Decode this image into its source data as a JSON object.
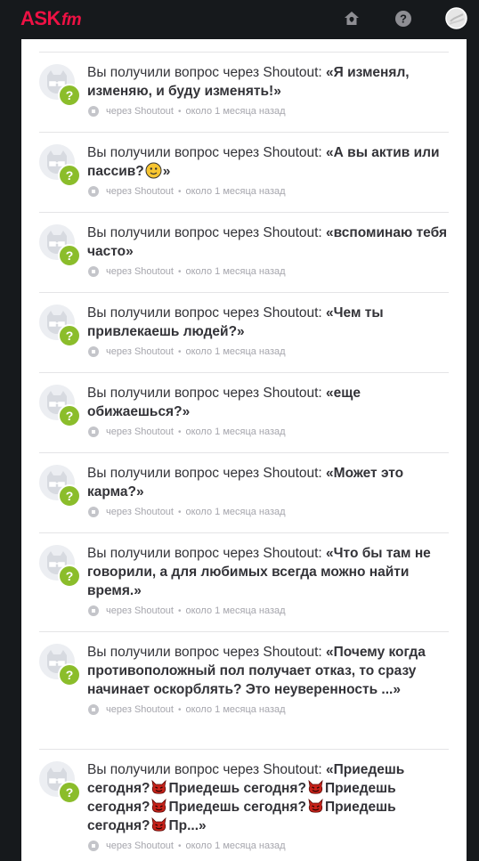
{
  "header": {
    "logo_main": "ASK",
    "logo_suffix": "fm",
    "icons": [
      "home-icon",
      "help-icon",
      "avatar-icon"
    ],
    "help_glyph": "?"
  },
  "colors": {
    "brand": "#ee1144",
    "question_badge": "#8bbd2b",
    "text": "#333338",
    "meta": "#a6a6ad",
    "background": "#16191c"
  },
  "feed": {
    "prefix": "Вы получили вопрос через Shoutout: ",
    "source": "через Shoutout",
    "separator": "•",
    "time": "около 1 месяца назад",
    "items": [
      {
        "question": "«Я изменял, изменяю, и буду изменять!»",
        "parts": [
          {
            "t": "«Я изменял, изменяю, и буду изменять!»"
          }
        ]
      },
      {
        "question": "«А вы актив или пассив?🙂»",
        "parts": [
          {
            "t": "«А вы актив или пассив?"
          },
          {
            "e": "smile"
          },
          {
            "t": "»"
          }
        ]
      },
      {
        "question": "«вспоминаю тебя часто»",
        "parts": [
          {
            "t": "«вспоминаю тебя часто»"
          }
        ]
      },
      {
        "question": "«Чем ты привлекаешь людей?»",
        "parts": [
          {
            "t": "«Чем ты привлекаешь людей?»"
          }
        ]
      },
      {
        "question": "«еще обижаешься?»",
        "parts": [
          {
            "t": "«еще обижаешься?»"
          }
        ]
      },
      {
        "question": "«Может это карма?»",
        "parts": [
          {
            "t": "«Может это карма?»"
          }
        ]
      },
      {
        "question": "«Что бы там не говорили, а для любимых всегда можно найти время.»",
        "parts": [
          {
            "t": "«Что бы там не говорили, а для любимых всегда можно найти время.»"
          }
        ]
      },
      {
        "question": "«Почему когда противоположный пол получает отказ, то сразу начинает оскорблять? Это неуверенность ...»",
        "parts": [
          {
            "t": "«Почему когда противоположный пол получает отказ, то сразу начинает оскорблять? Это неуверенность ...»"
          }
        ]
      },
      {
        "question": "«Приедешь сегодня?😈Приедешь сегодня?😈Приедешь сегодня?😈Приедешь сегодня?😈Приедешь сегодня?😈Пр...»",
        "parts": [
          {
            "t": "«Приедешь сегодня?"
          },
          {
            "e": "devil"
          },
          {
            "t": "Приедешь сегодня?"
          },
          {
            "e": "devil"
          },
          {
            "t": "Приедешь сегодня?"
          },
          {
            "e": "devil"
          },
          {
            "t": "Приедешь сегодня?"
          },
          {
            "e": "devil"
          },
          {
            "t": "Приедешь сегодня?"
          },
          {
            "e": "devil"
          },
          {
            "t": "Пр...»"
          }
        ]
      }
    ]
  }
}
